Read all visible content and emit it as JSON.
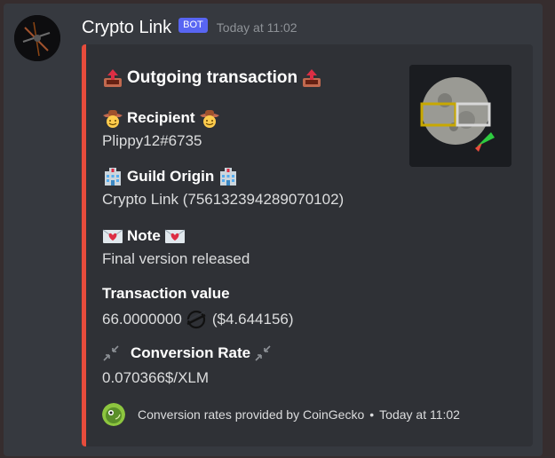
{
  "message": {
    "username": "Crypto Link",
    "badge": "BOT",
    "timestamp": "Today at 11:02"
  },
  "embed": {
    "accent_color": "#e74c3c",
    "title": "Outgoing transaction",
    "fields": {
      "recipient": {
        "name": "Recipient",
        "value": "Plippy12#6735"
      },
      "guild": {
        "name": "Guild Origin",
        "value": "Crypto Link (756132394289070102)"
      },
      "note": {
        "name": "Note",
        "value": "Final version released"
      },
      "tx": {
        "name": "Transaction value",
        "amount": "66.0000000",
        "usd": "($4.644156)"
      },
      "rate": {
        "name": "Conversion Rate",
        "value": "0.070366$/XLM"
      }
    },
    "footer": {
      "text": "Conversion rates provided by CoinGecko",
      "separator": "•",
      "time": "Today at 11:02"
    }
  },
  "icons": {
    "outbox": "outbox-tray-icon",
    "recipient": "cowboy-emoji-icon",
    "guild": "hospital-building-icon",
    "note": "love-letter-icon",
    "stellar": "stellar-xlm-icon",
    "rate": "arrows-compress-icon",
    "coingecko": "coingecko-icon"
  }
}
